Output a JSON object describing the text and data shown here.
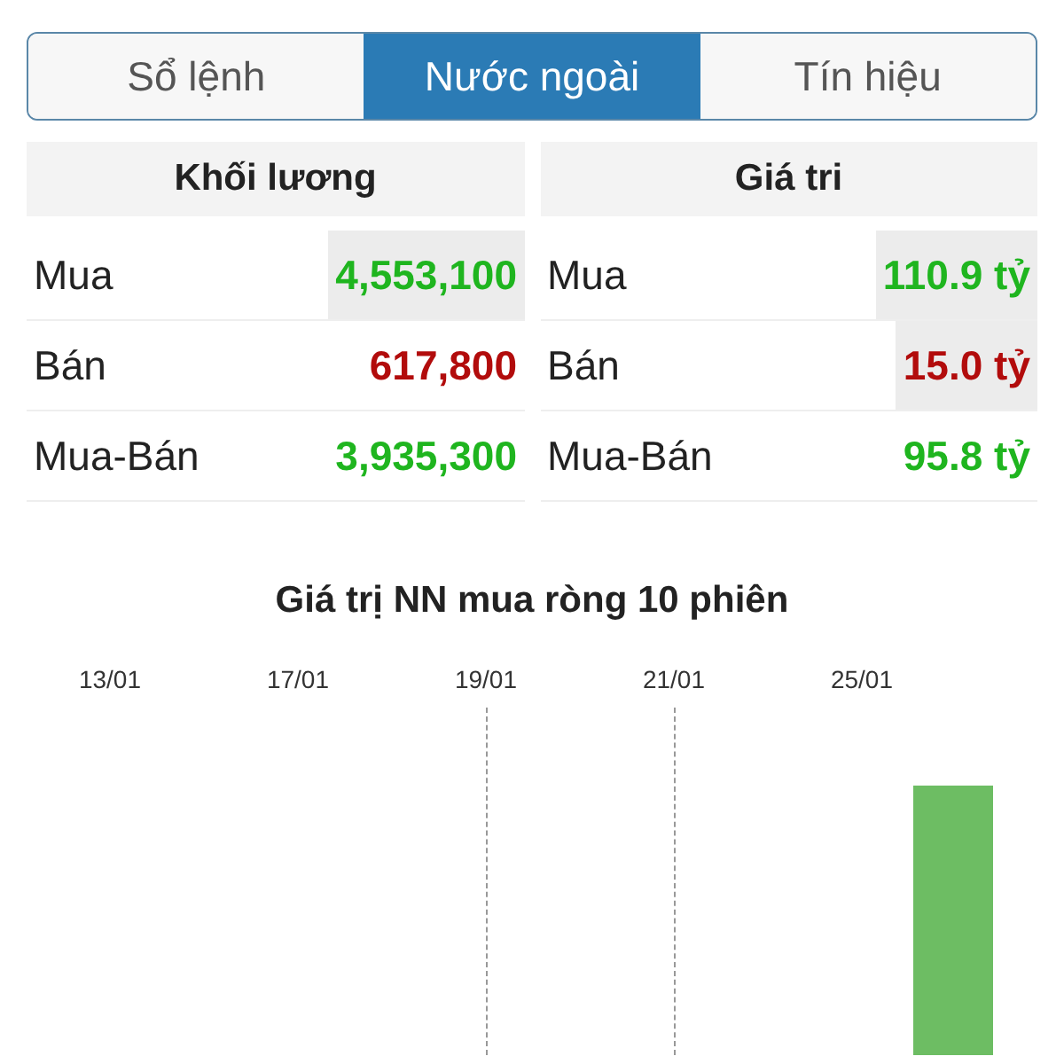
{
  "tabs": [
    {
      "label": "Sổ lệnh",
      "selected": false
    },
    {
      "label": "Nước ngoài",
      "selected": true
    },
    {
      "label": "Tín hiệu",
      "selected": false
    }
  ],
  "tables": [
    {
      "header": "Khối lương",
      "rows": [
        {
          "label": "Mua",
          "value": "4,553,100",
          "color": "#1fb51f",
          "highlighted": true
        },
        {
          "label": "Bán",
          "value": "617,800",
          "color": "#b20c0c",
          "highlighted": false
        },
        {
          "label": "Mua-Bán",
          "value": "3,935,300",
          "color": "#1fb51f",
          "highlighted": false
        }
      ]
    },
    {
      "header": "Giá tri",
      "rows": [
        {
          "label": "Mua",
          "value": "110.9 tỷ",
          "color": "#1fb51f",
          "highlighted": true
        },
        {
          "label": "Bán",
          "value": "15.0 tỷ",
          "color": "#b20c0c",
          "highlighted": true
        },
        {
          "label": "Mua-Bán",
          "value": "95.8 tỷ",
          "color": "#1fb51f",
          "highlighted": false
        }
      ]
    }
  ],
  "chart": {
    "title": "Giá trị NN mua ròng 10 phiên",
    "x_labels": [
      "13/01",
      "17/01",
      "19/01",
      "21/01",
      "25/01"
    ]
  }
}
